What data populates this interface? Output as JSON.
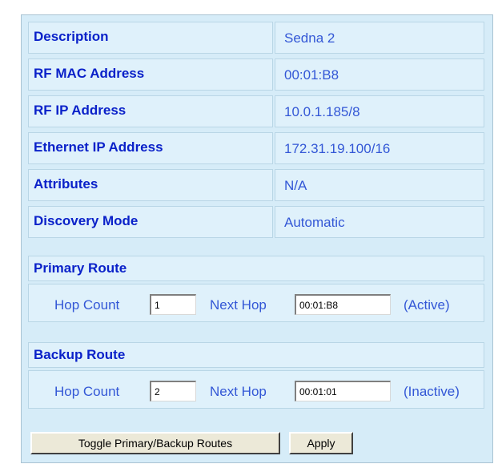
{
  "rows": [
    {
      "label": "Description",
      "value": "Sedna 2"
    },
    {
      "label": "RF MAC Address",
      "value": "00:01:B8"
    },
    {
      "label": "RF IP Address",
      "value": "10.0.1.185/8"
    },
    {
      "label": "Ethernet IP Address",
      "value": "172.31.19.100/16"
    },
    {
      "label": "Attributes",
      "value": "N/A"
    },
    {
      "label": "Discovery Mode",
      "value": "Automatic"
    }
  ],
  "primary": {
    "title": "Primary Route",
    "hop_count_label": "Hop Count",
    "hop_count": "1",
    "next_hop_label": "Next Hop",
    "next_hop": "00:01:B8",
    "status": "(Active)"
  },
  "backup": {
    "title": "Backup Route",
    "hop_count_label": "Hop Count",
    "hop_count": "2",
    "next_hop_label": "Next Hop",
    "next_hop": "00:01:01",
    "status": "(Inactive)"
  },
  "buttons": {
    "toggle": "Toggle Primary/Backup Routes",
    "apply": "Apply"
  },
  "colors": {
    "panel_bg": "#d6ecf8",
    "label": "#0a21c9",
    "value": "#3357d6"
  }
}
